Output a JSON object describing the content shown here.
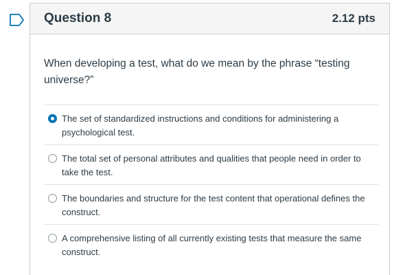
{
  "question": {
    "title": "Question 8",
    "points": "2.12 pts",
    "text": "When developing a test, what do we mean by the phrase “testing universe?”",
    "answers": [
      {
        "label": "The set of standardized instructions and conditions for administering a psychological test.",
        "selected": true
      },
      {
        "label": "The total set of personal attributes and qualities that people need in order to take the test.",
        "selected": false
      },
      {
        "label": "The boundaries and structure for the test content that operational defines the construct.",
        "selected": false
      },
      {
        "label": "A comprehensive listing of all currently existing tests that measure the same construct.",
        "selected": false
      }
    ]
  },
  "colors": {
    "accent": "#0374b5",
    "text": "#2d3b45",
    "header_bg": "#f5f5f5",
    "border": "#c7cdd1"
  },
  "icons": {
    "flag": "flag-question-icon"
  }
}
